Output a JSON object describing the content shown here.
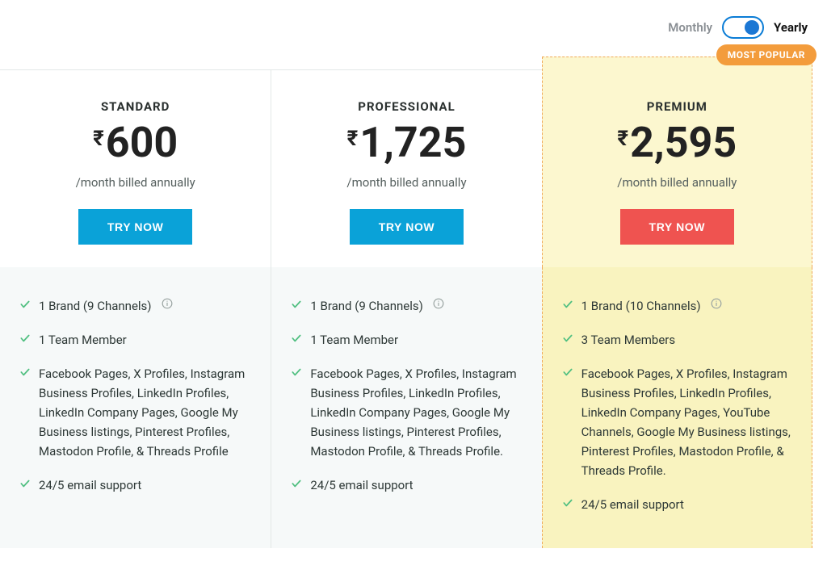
{
  "billing": {
    "monthly_label": "Monthly",
    "yearly_label": "Yearly",
    "active": "yearly"
  },
  "badge": "MOST POPULAR",
  "plans": [
    {
      "id": "standard",
      "name": "STANDARD",
      "currency": "₹",
      "price": "600",
      "period": "/month billed annually",
      "cta": "TRY NOW",
      "cta_color": "blue",
      "highlight": false,
      "features": [
        {
          "text": "1 Brand (9 Channels)",
          "info": true
        },
        {
          "text": "1 Team Member",
          "info": false
        },
        {
          "text": "Facebook Pages, X Profiles, Instagram Business Profiles, LinkedIn Profiles, LinkedIn Company Pages, Google My Business listings, Pinterest Profiles, Mastodon Profile, & Threads Profile",
          "info": false
        },
        {
          "text": "24/5 email support",
          "info": false
        }
      ]
    },
    {
      "id": "professional",
      "name": "PROFESSIONAL",
      "currency": "₹",
      "price": "1,725",
      "period": "/month billed annually",
      "cta": "TRY NOW",
      "cta_color": "blue",
      "highlight": false,
      "features": [
        {
          "text": "1 Brand (9 Channels)",
          "info": true
        },
        {
          "text": "1 Team Member",
          "info": false
        },
        {
          "text": "Facebook Pages, X Profiles, Instagram Business Profiles, LinkedIn Profiles, LinkedIn Company Pages, Google My Business listings, Pinterest Profiles, Mastodon Profile, & Threads Profile.",
          "info": false
        },
        {
          "text": "24/5 email support",
          "info": false
        }
      ]
    },
    {
      "id": "premium",
      "name": "PREMIUM",
      "currency": "₹",
      "price": "2,595",
      "period": "/month billed annually",
      "cta": "TRY NOW",
      "cta_color": "red",
      "highlight": true,
      "features": [
        {
          "text": "1 Brand (10 Channels)",
          "info": true
        },
        {
          "text": "3 Team Members",
          "info": false
        },
        {
          "text": "Facebook Pages, X Profiles, Instagram Business Profiles, LinkedIn Profiles, LinkedIn Company Pages, YouTube Channels, Google My Business listings, Pinterest Profiles, Mastodon Profile, & Threads Profile.",
          "info": false
        },
        {
          "text": "24/5 email support",
          "info": false
        }
      ]
    }
  ]
}
